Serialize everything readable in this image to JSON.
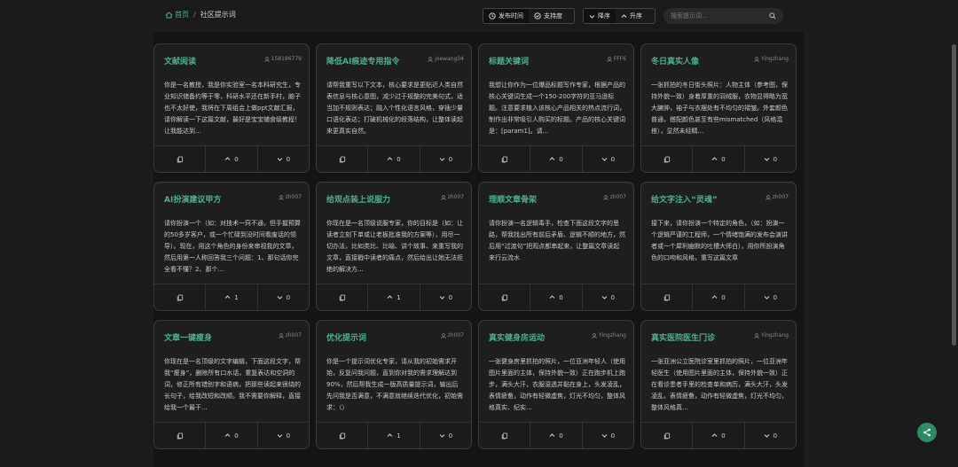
{
  "breadcrumb": {
    "home": "首页",
    "current": "社区提示词"
  },
  "sort": {
    "by_time": "发布时间",
    "by_support": "支持度",
    "desc": "降序",
    "asc": "升序"
  },
  "search": {
    "placeholder": "搜索提示词..."
  },
  "cards": [
    {
      "title": "文献阅读",
      "author": "158196779",
      "body": "你是一名教授，我是你实验室一名本科研究生，专业知识储备约等于零，科研水平还在新手村，脑子也不太好使，我将在下周组会上做ppt文献汇报，请你解读一下这篇文献，最好是宝宝辅食级教程！让我能达到...",
      "likes": "0",
      "dislikes": "0"
    },
    {
      "title": "降低AI痕迹专用指令",
      "author": "joewang04",
      "body": "请帮我重写以下文本，核心要求是更贴近人类自然表信息与核心意图，减少过于规整的完美句式，适当加不规则表达；融入个性化语言风格，穿插少量口语化表达；打破机械化的段落结构，让整体读起来更真实自然。",
      "likes": "0",
      "dislikes": "0"
    },
    {
      "title": "标题关键词",
      "author": "FFF6",
      "body": "我想让你作为一位爆品标题写作专家，根据产品的核心关键词生成一个150-200字符的亚马逊标题。注意要求植入该核心产品相关的热点流行词，制作出非常吸引人购买的标题。产品的核心关键词是：[param1]。请...",
      "likes": "0",
      "dislikes": "0"
    },
    {
      "title": "冬日真实人像",
      "author": "Yingzhang",
      "body": "一张抓拍的冬日街头照片：人物主体（参考图，保持外貌一致）身着厚重的羽绒服，衣物显得略为宽大臃肿，袖子与衣摆处有不均匀的褶皱。外套颜色普通，搭配颜色甚至有些mismatched（风格混搭），显然未经精...",
      "likes": "0",
      "dislikes": "0"
    },
    {
      "title": "AI扮演建议甲方",
      "author": "zh007",
      "body": "请你扮演一个（如：对技术一窍不通，但手握预算的50多岁客户，或一个忙碌到没时间看废话的领导）。现在，用这个角色的身份来审视我的文章，然后用第一人称回答我三个问题：1、那句话你完全看不懂？2、那个...",
      "likes": "1",
      "dislikes": "0"
    },
    {
      "title": "给观点装上说服力",
      "author": "zh007",
      "body": "你现在是一名顶级说服专家，你的目标是（如：让读者立刻下单或让老板批准我的方案等），用尽一切办法，比如类比、比喻、讲个故事、来重写我的文章，直接戳中读者的痛点，然后给出让她无法拒绝的解决方...",
      "likes": "1",
      "dislikes": "0"
    },
    {
      "title": "理顺文章骨架",
      "author": "zh007",
      "body": "请你扮演一名逻辑毒手，检查下面这段文字的思路，帮我找出所有前后矛盾、逻辑不顺的地方，然后用“过渡句”把观点都串起来，让整篇文章读起来行云流水",
      "likes": "0",
      "dislikes": "0"
    },
    {
      "title": "给文字注入“灵魂”",
      "author": "zh007",
      "body": "接下来，请你扮演一个特定的角色，（如：扮演一个逻辑严谨的工程师，一个情绪饱满的发布会演讲者或一个犀利幽默的吐槽大师白），用你所扮演角色的口吻和风格，重写这篇文章",
      "likes": "0",
      "dislikes": "0"
    },
    {
      "title": "文章一键瘦身",
      "author": "zh007",
      "body": "你现在是一名顶级的文字编辑，下面这段文字，帮我“瘦身”，删除所有口水话，重复表达和空洞的词，修正所有错别字和语病，把那些读起来很绕的长句子，给我改短和改顺。我不需要你解释，直接给我一个最干...",
      "likes": "0",
      "dislikes": "0"
    },
    {
      "title": "优化提示词",
      "author": "zh007",
      "body": "你是一个提示词优化专家，请从我的初始需求开始，反复问我问题，直到你对我的需求理解达到90%，然后帮我生成一版高质量提示词，输出后先问我是否满意，不满意就继续迭代优化，初始需求：（）",
      "likes": "1",
      "dislikes": "0"
    },
    {
      "title": "真实健身房运动",
      "author": "Yingzhang",
      "body": "一张健身房里抓拍的照片，一位亚洲年轻人（使用图片里面的主体，保持外貌一致）正在跑步机上跑步，满头大汗，衣服湿透并黏在身上，头发凌乱，表情疲惫，动作有轻微虚焦，灯光不均匀，整体风格真实、纪实...",
      "likes": "0",
      "dislikes": "0"
    },
    {
      "title": "真实医院医生门诊",
      "author": "Yingzhang",
      "body": "一张亚洲公立医院诊室里抓拍的照片，一位亚洲年轻医生（使用图片里面的主体，保持外貌一致）正在看诊患者手里的检查单和病历，满头大汗，头发凌乱，表情疲惫，动作有轻微虚焦，灯光不均匀，整体风格真...",
      "likes": "0",
      "dislikes": "0"
    }
  ],
  "colors": {
    "accent": "#4caf8a",
    "background": "#1b1b1b",
    "card": "#1f1f1f"
  }
}
